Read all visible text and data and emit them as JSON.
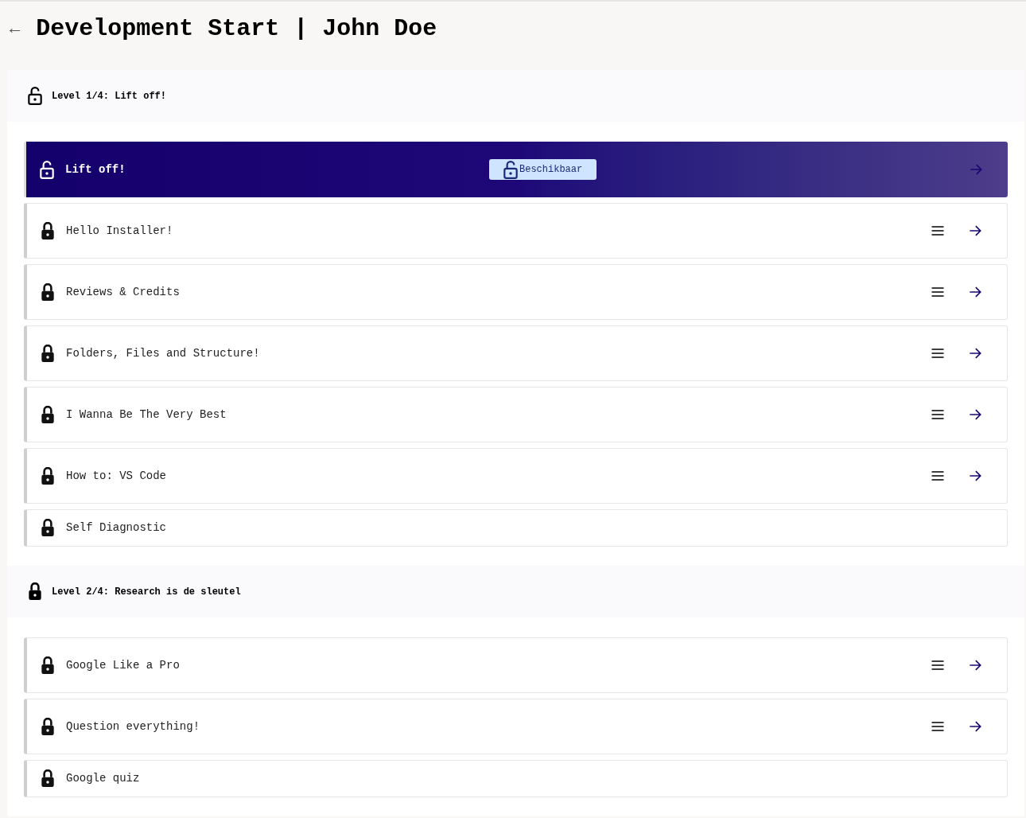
{
  "header": {
    "back": "←",
    "title": "Development Start | John Doe"
  },
  "levels": [
    {
      "title": "Level 1/4: Lift off!",
      "unlocked": true,
      "lessons": [
        {
          "title": "Lift off!",
          "unlocked": true,
          "selected": true,
          "badge": "Beschikbaar",
          "has_actions": true
        },
        {
          "title": "Hello Installer!",
          "unlocked": false,
          "selected": false,
          "has_actions": true
        },
        {
          "title": "Reviews & Credits",
          "unlocked": false,
          "selected": false,
          "has_actions": true
        },
        {
          "title": "Folders, Files and Structure!",
          "unlocked": false,
          "selected": false,
          "has_actions": true
        },
        {
          "title": "I Wanna Be The Very Best",
          "unlocked": false,
          "selected": false,
          "has_actions": true
        },
        {
          "title": "How to: VS Code",
          "unlocked": false,
          "selected": false,
          "has_actions": true
        },
        {
          "title": "Self Diagnostic",
          "unlocked": false,
          "selected": false,
          "has_actions": false
        }
      ]
    },
    {
      "title": "Level 2/4: Research is de sleutel",
      "unlocked": false,
      "lessons": [
        {
          "title": "Google Like a Pro",
          "unlocked": false,
          "selected": false,
          "has_actions": true
        },
        {
          "title": "Question everything!",
          "unlocked": false,
          "selected": false,
          "has_actions": true
        },
        {
          "title": "Google quiz",
          "unlocked": false,
          "selected": false,
          "has_actions": false
        }
      ]
    }
  ]
}
